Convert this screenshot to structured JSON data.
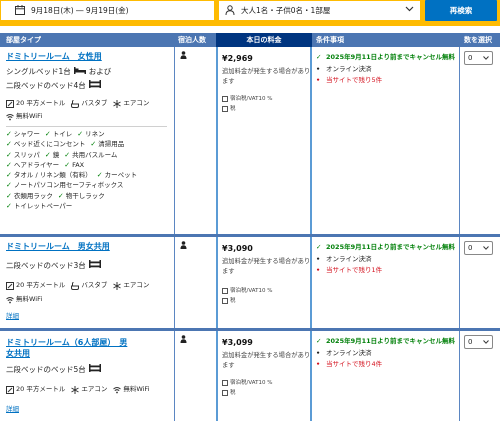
{
  "search": {
    "dates": "9月18日(木) ― 9月19日(金)",
    "guests": "大人1名・子供0名・1部屋",
    "button": "再検索"
  },
  "table": {
    "headers": {
      "room_type": "部屋タイプ",
      "occupancy": "宿泊人数",
      "price": "本日の料金",
      "conditions": "条件事項",
      "select": "数を選択"
    }
  },
  "rooms": [
    {
      "title": "ドミトリールーム　女性用",
      "bed_line1": "シングルベッド1台",
      "bed_line1_suffix": "および",
      "bed_line2": "二段ベッドのベッド4台",
      "amenities": [
        "20 平方メートル",
        "バスタブ",
        "エアコン"
      ],
      "wifi": "無料WiFi",
      "features": [
        [
          "シャワー",
          "トイレ",
          "リネン"
        ],
        [
          "ベッド近くにコンセント",
          "清掃用品"
        ],
        [
          "スリッパ",
          "鏡",
          "共用バスルーム"
        ],
        [
          "ヘアドライヤー",
          "FAX"
        ],
        [
          "タオル / リネン類（有料）",
          "カーペット"
        ],
        [
          "ノートパソコン用セーフティボックス"
        ],
        [
          "衣類用ラック",
          "物干しラック"
        ],
        [
          "トイレットペーパー"
        ]
      ],
      "price": "¥2,969",
      "price_note": "追加料金が発生する場合があります",
      "tax": "宿泊税/VAT10 %",
      "tax2": "税",
      "cond1": "2025年9月11日より前までキャンセル無料",
      "cond2": "オンライン決済",
      "cond3": "当サイトで残り5件",
      "select": "0"
    },
    {
      "title": "ドミトリールーム　男女共用",
      "bed_line1": "二段ベッドのベッド3台",
      "amenities": [
        "20 平方メートル",
        "バスタブ",
        "エアコン"
      ],
      "wifi": "無料WiFi",
      "detail": "詳細",
      "price": "¥3,090",
      "price_note": "追加料金が発生する場合があります",
      "tax": "宿泊税/VAT10 %",
      "tax2": "税",
      "cond1": "2025年9月11日より前までキャンセル無料",
      "cond2": "オンライン決済",
      "cond3": "当サイトで残り1件",
      "select": "0"
    },
    {
      "title_line1": "ドミトリールーム（6人部屋）　男",
      "title_line2": "女共用",
      "bed_line1": "二段ベッドのベッド5台",
      "amenities": [
        "20 平方メートル",
        "エアコン",
        "無料WiFi"
      ],
      "detail": "詳細",
      "price": "¥3,099",
      "price_note": "追加料金が発生する場合があります",
      "tax": "宿泊税/VAT10 %",
      "tax2": "税",
      "cond1": "2025年9月11日より前までキャンセル無料",
      "cond2": "オンライン決済",
      "cond3": "当サイトで残り4件",
      "select": "0"
    }
  ],
  "colors": {
    "brand_yellow": "#febb02",
    "header_blue": "#4c76b2",
    "price_header": "#003580",
    "link_blue": "#0071c2",
    "green": "#008009",
    "red": "#d4111e"
  }
}
